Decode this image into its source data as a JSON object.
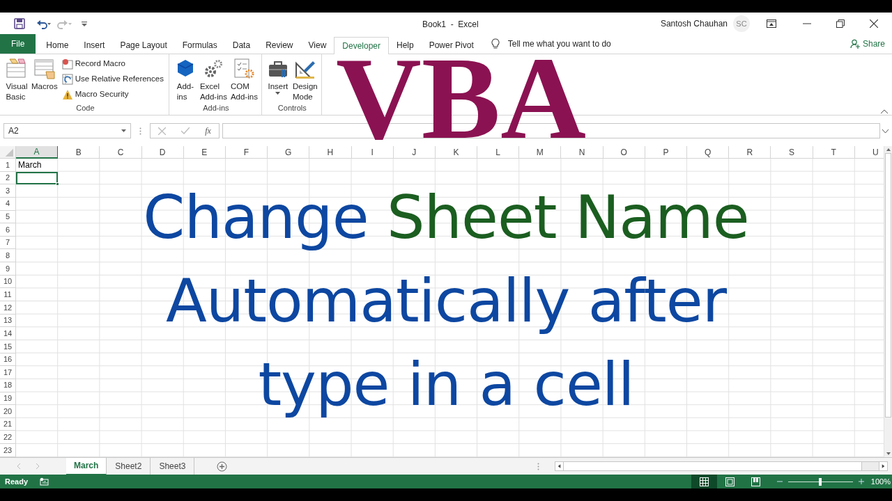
{
  "title_bar": {
    "document_title": "Book1  -  Excel",
    "user_name": "Santosh Chauhan",
    "user_initials": "SC"
  },
  "ribbon_tabs": [
    {
      "label": "File",
      "kind": "file",
      "selected": false
    },
    {
      "label": "Home",
      "kind": "tab",
      "selected": false
    },
    {
      "label": "Insert",
      "kind": "tab",
      "selected": false
    },
    {
      "label": "Page Layout",
      "kind": "tab",
      "selected": false
    },
    {
      "label": "Formulas",
      "kind": "tab",
      "selected": false
    },
    {
      "label": "Data",
      "kind": "tab",
      "selected": false
    },
    {
      "label": "Review",
      "kind": "tab",
      "selected": false
    },
    {
      "label": "View",
      "kind": "tab",
      "selected": false
    },
    {
      "label": "Developer",
      "kind": "tab",
      "selected": true
    },
    {
      "label": "Help",
      "kind": "tab",
      "selected": false
    },
    {
      "label": "Power Pivot",
      "kind": "tab",
      "selected": false
    }
  ],
  "tell_me": "Tell me what you want to do",
  "share": "Share",
  "ribbon_groups": [
    {
      "label": "Code",
      "big_buttons": [
        {
          "lines": [
            "Visual",
            "Basic"
          ]
        },
        {
          "lines": [
            "Macros"
          ]
        }
      ],
      "small_buttons": [
        {
          "label": "Record Macro"
        },
        {
          "label": "Use Relative References"
        },
        {
          "label": "Macro Security"
        }
      ]
    },
    {
      "label": "Add-ins",
      "big_buttons": [
        {
          "lines": [
            "Add-",
            "ins"
          ]
        },
        {
          "lines": [
            "Excel",
            "Add-ins"
          ]
        },
        {
          "lines": [
            "COM",
            "Add-ins"
          ]
        }
      ]
    },
    {
      "label": "Controls",
      "big_buttons": [
        {
          "lines": [
            "Insert"
          ],
          "dropdown": true
        },
        {
          "lines": [
            "Design",
            "Mode"
          ],
          "dropdown": false
        }
      ]
    }
  ],
  "formula_bar": {
    "name_box": "A2",
    "function_label": "fx"
  },
  "columns": [
    "A",
    "B",
    "C",
    "D",
    "E",
    "F",
    "G",
    "H",
    "I",
    "J",
    "K",
    "L",
    "M",
    "N",
    "O",
    "P",
    "Q",
    "R",
    "S",
    "T",
    "U"
  ],
  "rows": [
    {
      "label": "1",
      "cells": [
        {
          "value": "March",
          "selected": false
        }
      ]
    },
    {
      "label": "2",
      "cells": [
        {
          "selected": true
        }
      ]
    },
    {
      "label": "3"
    },
    {
      "label": "4"
    },
    {
      "label": "5"
    },
    {
      "label": "6"
    },
    {
      "label": "7"
    },
    {
      "label": "8"
    },
    {
      "label": "9"
    },
    {
      "label": "10"
    },
    {
      "label": "11"
    },
    {
      "label": "12"
    },
    {
      "label": "13"
    },
    {
      "label": "14"
    },
    {
      "label": "15"
    },
    {
      "label": "16"
    },
    {
      "label": "17"
    },
    {
      "label": "18"
    },
    {
      "label": "19"
    },
    {
      "label": "20"
    },
    {
      "label": "21"
    },
    {
      "label": "22"
    },
    {
      "label": "23"
    }
  ],
  "sheet_tabs": [
    {
      "label": "March",
      "selected": true
    },
    {
      "label": "Sheet2",
      "selected": false
    },
    {
      "label": "Sheet3",
      "selected": false
    }
  ],
  "status_bar": {
    "status": "Ready",
    "zoom": "100%",
    "zoom_slider": {
      "level": 0.5
    },
    "views": [
      {
        "kind": "normal",
        "selected": true
      },
      {
        "kind": "page-layout",
        "selected": false
      },
      {
        "kind": "page-break",
        "selected": false
      }
    ]
  },
  "overlay": {
    "badge": "VBA",
    "lines": [
      [
        {
          "text": "Change ",
          "color": "#0d47a1"
        },
        {
          "text": "Sheet Name",
          "color": "#1b5e20"
        }
      ],
      [
        {
          "text": "Automatically after",
          "color": "#0d47a1"
        }
      ],
      [
        {
          "text": "type in a cell",
          "color": "#0d47a1"
        }
      ]
    ]
  }
}
